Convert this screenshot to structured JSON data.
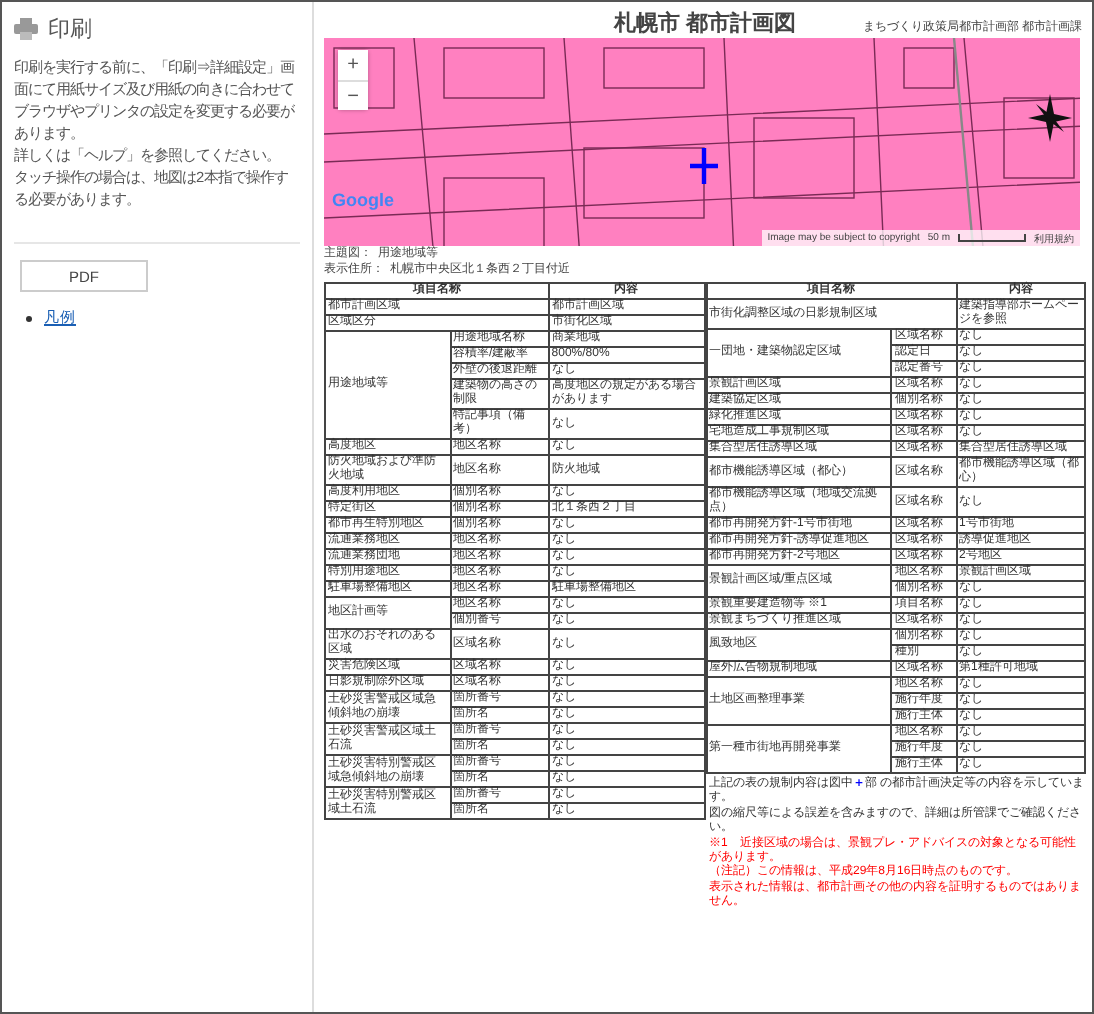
{
  "side_panel": {
    "title": "印刷",
    "paragraphs": [
      "印刷を実行する前に、「印刷⇒詳細設定」画面にて用紙サイズ及び用紙の向きに合わせてブラウザやプリンタの設定を変更する必要があります。",
      "詳しくは「ヘルプ」を参照してください。",
      "タッチ操作の場合は、地図は2本指で操作する必要があります。"
    ],
    "pdf_button": "PDF",
    "links": [
      "凡例"
    ]
  },
  "header": {
    "title": "札幌市 都市計画図",
    "department": "まちづくり政策局都市計画部 都市計画課"
  },
  "map": {
    "zoom_in": "+",
    "zoom_out": "−",
    "logo": "Google",
    "attribution": "Image may be subject to copyright",
    "scale": "50 m",
    "terms": "利用規約"
  },
  "theme": {
    "label": "主題図：",
    "value": "用途地域等"
  },
  "address": {
    "label": "表示住所：",
    "value": "札幌市中央区北１条西２丁目付近"
  },
  "tables": [
    {
      "columns": [
        "項目名称",
        "内容"
      ],
      "groups": [
        {
          "item": "都市計画区域",
          "entries": [
            {
              "value": "都市計画区域"
            }
          ]
        },
        {
          "item": "区域区分",
          "entries": [
            {
              "value": "市街化区域"
            }
          ]
        },
        {
          "item": "用途地域等",
          "entries": [
            {
              "field": "用途地域名称",
              "value": "商業地域"
            },
            {
              "field": "容積率/建蔽率",
              "value": "800%/80%"
            },
            {
              "field": "外壁の後退距離",
              "value": "なし"
            },
            {
              "field": "建築物の高さの制限",
              "value": "高度地区の規定がある場合があります"
            },
            {
              "field": "特記事項（備考）",
              "value": "なし"
            }
          ]
        },
        {
          "item": "高度地区",
          "entries": [
            {
              "field": "地区名称",
              "value": "なし"
            }
          ]
        },
        {
          "item": "防火地域および準防火地域",
          "entries": [
            {
              "field": "地区名称",
              "value": "防火地域"
            }
          ]
        },
        {
          "item": "高度利用地区",
          "entries": [
            {
              "field": "個別名称",
              "value": "なし"
            }
          ]
        },
        {
          "item": "特定街区",
          "entries": [
            {
              "field": "個別名称",
              "value": "北１条西２丁目"
            }
          ]
        },
        {
          "item": "都市再生特別地区",
          "entries": [
            {
              "field": "個別名称",
              "value": "なし"
            }
          ]
        },
        {
          "item": "流通業務地区",
          "entries": [
            {
              "field": "地区名称",
              "value": "なし"
            }
          ]
        },
        {
          "item": "流通業務団地",
          "entries": [
            {
              "field": "地区名称",
              "value": "なし"
            }
          ]
        },
        {
          "item": "特別用途地区",
          "entries": [
            {
              "field": "地区名称",
              "value": "なし"
            }
          ]
        },
        {
          "item": "駐車場整備地区",
          "entries": [
            {
              "field": "地区名称",
              "value": "駐車場整備地区"
            }
          ]
        },
        {
          "item": "地区計画等",
          "entries": [
            {
              "field": "地区名称",
              "value": "なし"
            },
            {
              "field": "個別番号",
              "value": "なし"
            }
          ]
        },
        {
          "item": "出水のおそれのある区域",
          "entries": [
            {
              "field": "区域名称",
              "value": "なし"
            }
          ]
        },
        {
          "item": "災害危険区域",
          "entries": [
            {
              "field": "区域名称",
              "value": "なし"
            }
          ]
        },
        {
          "item": "日影規制除外区域",
          "entries": [
            {
              "field": "区域名称",
              "value": "なし"
            }
          ]
        },
        {
          "item": "土砂災害警戒区域急傾斜地の崩壊",
          "entries": [
            {
              "field": "箇所番号",
              "value": "なし"
            },
            {
              "field": "箇所名",
              "value": "なし"
            }
          ]
        },
        {
          "item": "土砂災害警戒区域土石流",
          "entries": [
            {
              "field": "箇所番号",
              "value": "なし"
            },
            {
              "field": "箇所名",
              "value": "なし"
            }
          ]
        },
        {
          "item": "土砂災害特別警戒区域急傾斜地の崩壊",
          "entries": [
            {
              "field": "箇所番号",
              "value": "なし"
            },
            {
              "field": "箇所名",
              "value": "なし"
            }
          ]
        },
        {
          "item": "土砂災害特別警戒区域土石流",
          "entries": [
            {
              "field": "箇所番号",
              "value": "なし"
            },
            {
              "field": "箇所名",
              "value": "なし"
            }
          ]
        }
      ]
    },
    {
      "columns": [
        "項目名称",
        "内容"
      ],
      "groups": [
        {
          "item": "市街化調整区域の日影規制区域",
          "entries": [
            {
              "value": "建築指導部ホームページを参照"
            }
          ]
        },
        {
          "item": "一団地・建築物認定区域",
          "entries": [
            {
              "field": "区域名称",
              "value": "なし"
            },
            {
              "field": "認定日",
              "value": "なし"
            },
            {
              "field": "認定番号",
              "value": "なし"
            }
          ]
        },
        {
          "item": "景観計画区域",
          "entries": [
            {
              "field": "区域名称",
              "value": "なし"
            }
          ]
        },
        {
          "item": "建築協定区域",
          "entries": [
            {
              "field": "個別名称",
              "value": "なし"
            }
          ]
        },
        {
          "item": "緑化推進区域",
          "entries": [
            {
              "field": "区域名称",
              "value": "なし"
            }
          ]
        },
        {
          "item": "宅地造成工事規制区域",
          "entries": [
            {
              "field": "区域名称",
              "value": "なし"
            }
          ]
        },
        {
          "item": "集合型居住誘導区域",
          "entries": [
            {
              "field": "区域名称",
              "value": "集合型居住誘導区域"
            }
          ]
        },
        {
          "item": "都市機能誘導区域（都心）",
          "entries": [
            {
              "field": "区域名称",
              "value": "都市機能誘導区域（都心）"
            }
          ]
        },
        {
          "item": "都市機能誘導区域（地域交流拠点）",
          "entries": [
            {
              "field": "区域名称",
              "value": "なし"
            }
          ]
        },
        {
          "item": "都市再開発方針-1号市街地",
          "entries": [
            {
              "field": "区域名称",
              "value": "1号市街地"
            }
          ]
        },
        {
          "item": "都市再開発方針-誘導促進地区",
          "entries": [
            {
              "field": "区域名称",
              "value": "誘導促進地区"
            }
          ]
        },
        {
          "item": "都市再開発方針-2号地区",
          "entries": [
            {
              "field": "区域名称",
              "value": "2号地区"
            }
          ]
        },
        {
          "item": "景観計画区域/重点区域",
          "entries": [
            {
              "field": "地区名称",
              "value": "景観計画区域"
            },
            {
              "field": "個別名称",
              "value": "なし"
            }
          ]
        },
        {
          "item": "景観重要建造物等 ※1",
          "entries": [
            {
              "field": "項目名称",
              "value": "なし"
            }
          ]
        },
        {
          "item": "景観まちづくり推進区域",
          "entries": [
            {
              "field": "区域名称",
              "value": "なし"
            }
          ]
        },
        {
          "item": "風致地区",
          "entries": [
            {
              "field": "個別名称",
              "value": "なし"
            },
            {
              "field": "種別",
              "value": "なし"
            }
          ]
        },
        {
          "item": "屋外広告物規制地域",
          "entries": [
            {
              "field": "区域名称",
              "value": "第1種許可地域"
            }
          ]
        },
        {
          "item": "土地区画整理事業",
          "entries": [
            {
              "field": "地区名称",
              "value": "なし"
            },
            {
              "field": "施行年度",
              "value": "なし"
            },
            {
              "field": "施行主体",
              "value": "なし"
            }
          ]
        },
        {
          "item": "第一種市街地再開発事業",
          "entries": [
            {
              "field": "地区名称",
              "value": "なし"
            },
            {
              "field": "施行年度",
              "value": "なし"
            },
            {
              "field": "施行主体",
              "value": "なし"
            }
          ]
        }
      ]
    }
  ],
  "notes": [
    {
      "before": "上記の表の規制内容は図中",
      "mark": "＋",
      "after": "部 の都市計画決定等の内容を示しています。",
      "color": "#333333"
    },
    {
      "before": "図の縮尺等による誤差を含みますので、詳細は所管課でご確認ください。",
      "color": "#333333"
    },
    {
      "before": "※1　近接区域の場合は、景観プレ・アドバイスの対象となる可能性があります。",
      "color": "#ff0000"
    },
    {
      "before": "（注記）この情報は、平成29年8月16日時点のものです。",
      "color": "#ff0000"
    },
    {
      "before": "表示された情報は、都市計画その他の内容を証明するものではありません。",
      "color": "#ff0000"
    }
  ]
}
